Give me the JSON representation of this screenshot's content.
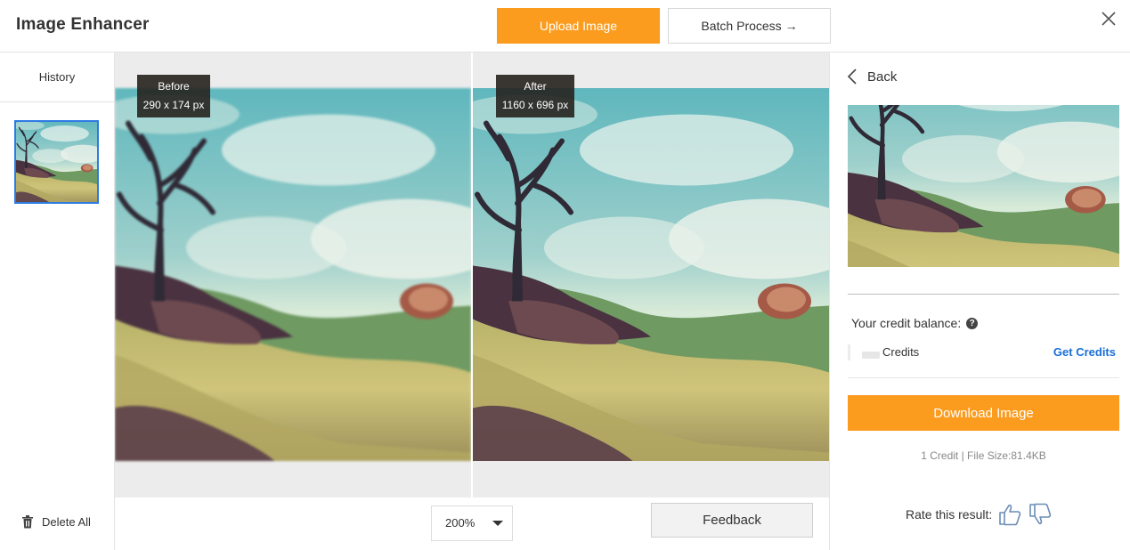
{
  "header": {
    "title": "Image Enhancer",
    "upload_label": "Upload Image",
    "batch_label": "Batch Process →",
    "close_icon": "close-icon"
  },
  "history": {
    "title": "History",
    "delete_all_label": "Delete All",
    "delete_icon": "trash-icon"
  },
  "compare": {
    "before": {
      "label": "Before",
      "size": "290 x 174 px"
    },
    "after": {
      "label": "After",
      "size": "1160 x 696 px"
    }
  },
  "toolbar": {
    "zoom_value": "200%",
    "feedback_label": "Feedback"
  },
  "result_panel": {
    "back_label": "Back",
    "credit_balance_label": "Your credit balance:",
    "credits_label": "Credits",
    "get_credits_label": "Get Credits",
    "download_label": "Download Image",
    "file_info": "1 Credit | File Size:81.4KB",
    "rate_label": "Rate this result:"
  },
  "colors": {
    "accent": "#fb9c1f",
    "link": "#1a6fd6",
    "selected_border": "#2e7be3"
  }
}
